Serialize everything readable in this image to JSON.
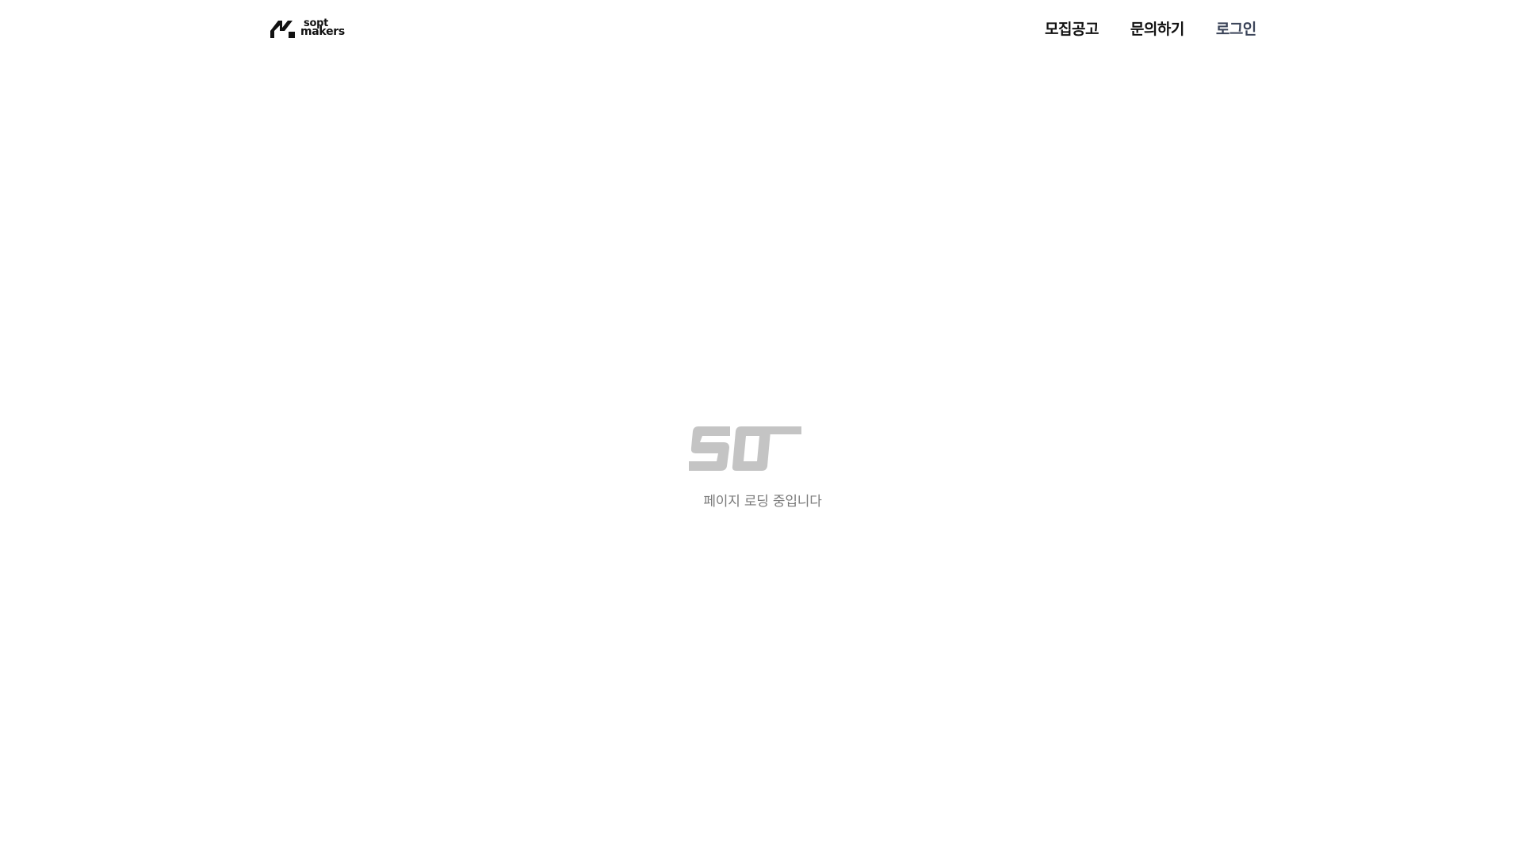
{
  "header": {
    "logo": {
      "line1": "sopt",
      "line2": "makers"
    },
    "nav": [
      {
        "label": "모집공고"
      },
      {
        "label": "문의하기"
      },
      {
        "label": "로그인"
      }
    ]
  },
  "loading": {
    "message": "페이지 로딩 중입니다",
    "logo_color": "#c4c4c4"
  },
  "colors": {
    "background": "#ffffff",
    "text_primary": "#111111",
    "login_accent": "#3b4459",
    "loading_text": "#7a7a7a"
  }
}
